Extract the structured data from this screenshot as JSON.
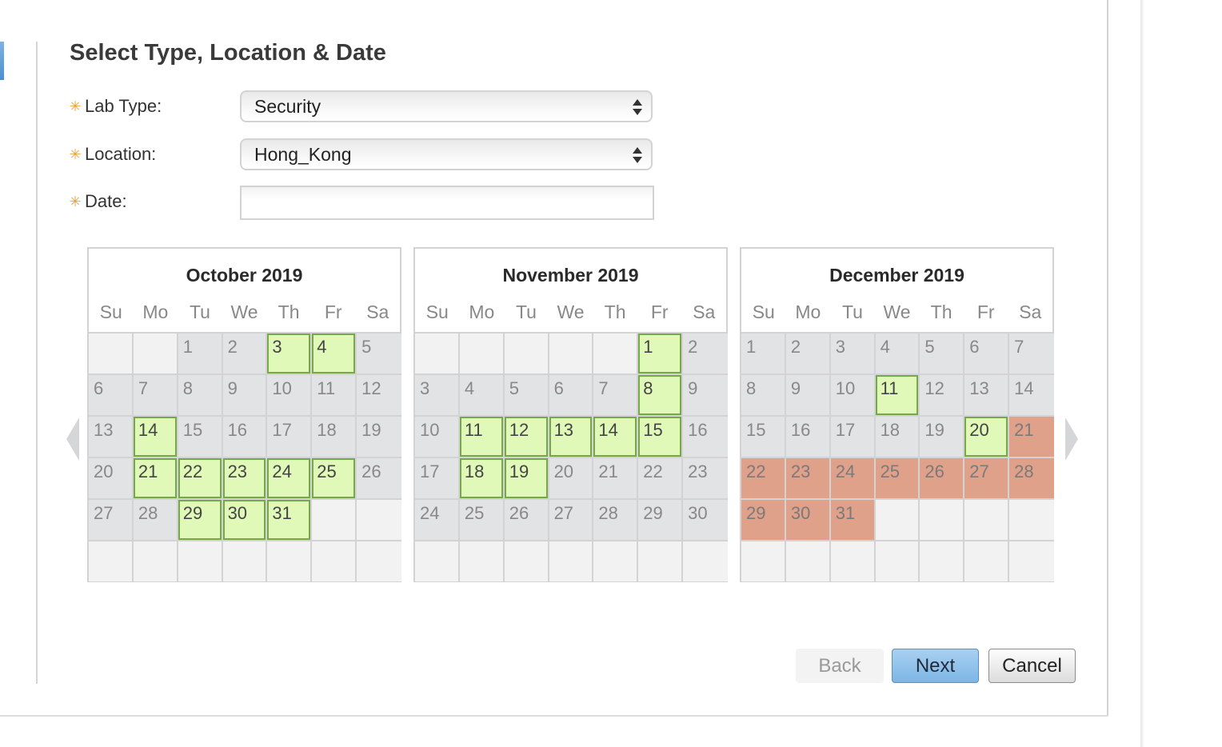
{
  "page": {
    "title": "Select Type, Location & Date"
  },
  "form": {
    "lab_type": {
      "label": "Lab Type:",
      "value": "Security",
      "required_icon": "asterisk-icon"
    },
    "location": {
      "label": "Location:",
      "value": "Hong_Kong",
      "required_icon": "asterisk-icon"
    },
    "date": {
      "label": "Date:",
      "value": "",
      "placeholder": "",
      "required_icon": "asterisk-icon"
    }
  },
  "calendar": {
    "weekdays": [
      "Su",
      "Mo",
      "Tu",
      "We",
      "Th",
      "Fr",
      "Sa"
    ],
    "prev_icon": "chevron-left-icon",
    "next_icon": "chevron-right-icon",
    "months": [
      {
        "title": "October 2019",
        "first_weekday": 2,
        "days_in_month": 31,
        "available": [
          3,
          4,
          14,
          21,
          22,
          23,
          24,
          25,
          29,
          30,
          31
        ],
        "blocked": []
      },
      {
        "title": "November 2019",
        "first_weekday": 5,
        "days_in_month": 30,
        "available": [
          1,
          8,
          11,
          12,
          13,
          14,
          15,
          18,
          19
        ],
        "blocked": []
      },
      {
        "title": "December 2019",
        "first_weekday": 0,
        "days_in_month": 31,
        "available": [
          11,
          20
        ],
        "blocked": [
          21,
          22,
          23,
          24,
          25,
          26,
          27,
          28,
          29,
          30,
          31
        ]
      }
    ]
  },
  "buttons": {
    "back": "Back",
    "next": "Next",
    "cancel": "Cancel"
  },
  "colors": {
    "available": "#e0f8b8",
    "available_border": "#76a84a",
    "blocked": "#e0a18a",
    "unavailable": "#e2e3e5",
    "required": "#e8a23a",
    "primary_button": "#7db6e6"
  }
}
